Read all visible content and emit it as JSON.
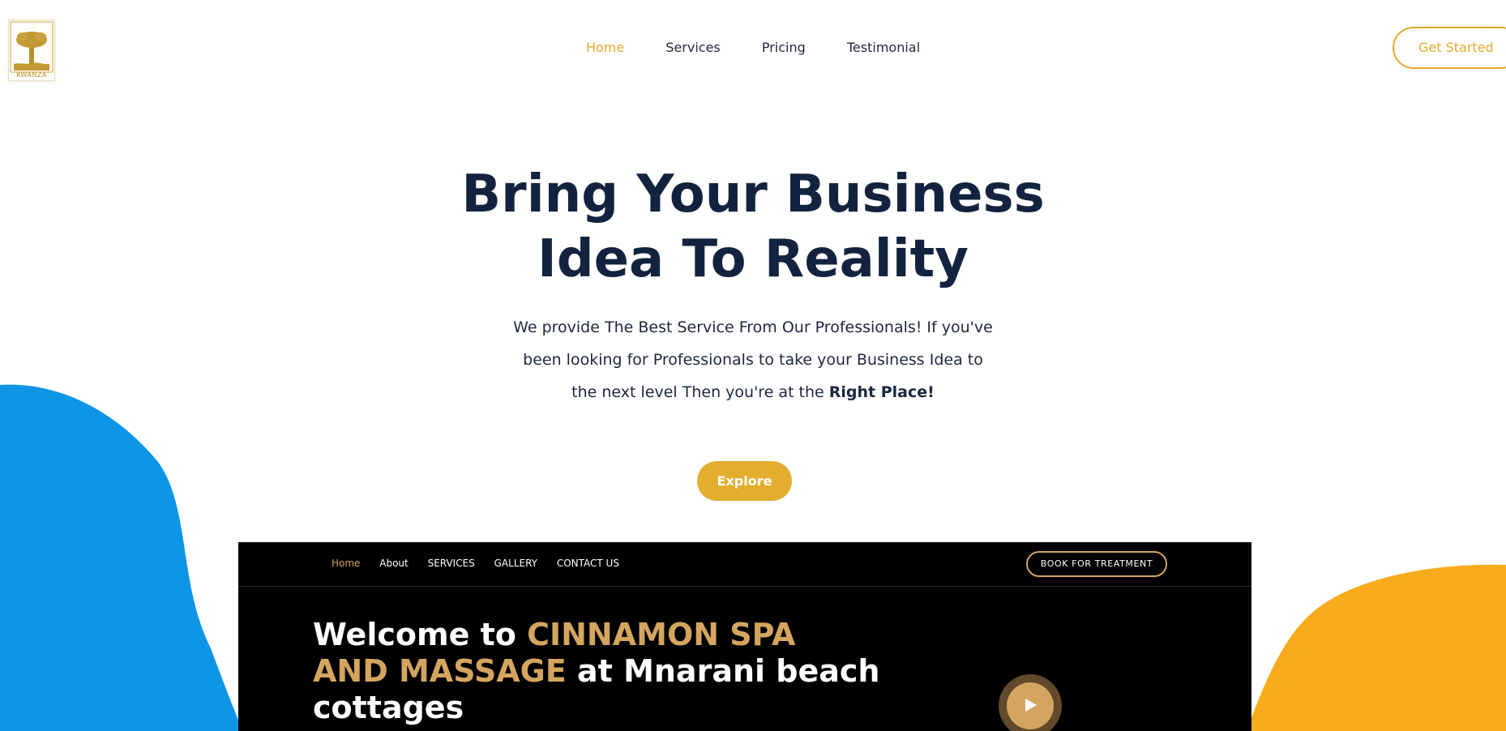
{
  "logo": {
    "text": "KWANZA"
  },
  "nav": {
    "items": [
      {
        "label": "Home",
        "active": true
      },
      {
        "label": "Services",
        "active": false
      },
      {
        "label": "Pricing",
        "active": false
      },
      {
        "label": "Testimonial",
        "active": false
      }
    ],
    "cta_label": "Get Started"
  },
  "hero": {
    "title_line1": "Bring Your Business",
    "title_line2": "Idea To Reality",
    "text_part1": "We provide The Best Service From Our Professionals! If you've been looking for Professionals to take your Business Idea to the next level Then you're at the ",
    "text_bold": "Right Place!",
    "button_label": "Explore"
  },
  "spa_preview": {
    "nav_items": [
      {
        "label": "Home",
        "active": true
      },
      {
        "label": "About",
        "active": false
      },
      {
        "label": "SERVICES",
        "active": false
      },
      {
        "label": "GALLERY",
        "active": false
      },
      {
        "label": "CONTACT US",
        "active": false
      }
    ],
    "book_label": "BOOK FOR TREATMENT",
    "heading_part1": "Welcome to ",
    "heading_gold": "CINNAMON SPA AND MASSAGE",
    "heading_part2": " at Mnarani beach cottages"
  },
  "colors": {
    "accent": "#e6a82b",
    "heading": "#13233f",
    "blob_left": "#0e95e5",
    "blob_right": "#f8ac1d",
    "spa_gold": "#d4a55f"
  },
  "icons": {
    "play": "play-icon",
    "logo": "baobab-tree-logo"
  }
}
